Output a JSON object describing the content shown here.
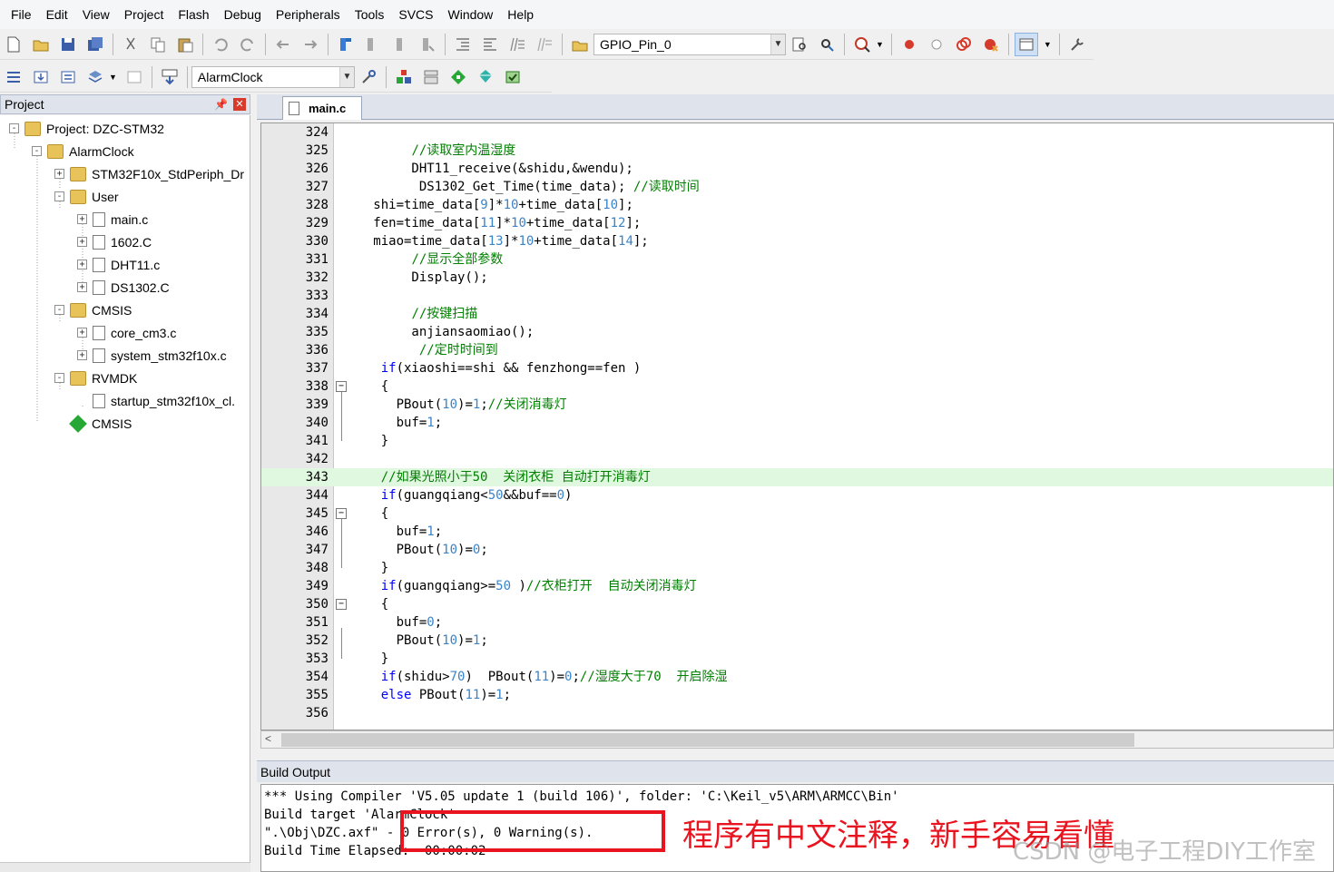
{
  "menu": [
    "File",
    "Edit",
    "View",
    "Project",
    "Flash",
    "Debug",
    "Peripherals",
    "Tools",
    "SVCS",
    "Window",
    "Help"
  ],
  "toolbar1": {
    "icons": [
      "new-file",
      "open-file",
      "save",
      "save-all",
      "cut",
      "copy",
      "paste",
      "undo",
      "redo",
      "nav-back",
      "nav-forward",
      "bookmark",
      "prev-bookmark",
      "next-bookmark",
      "clear-bookmarks",
      "indent",
      "unindent",
      "comment",
      "uncomment",
      "find-in-files"
    ],
    "find_combo": "GPIO_Pin_0",
    "icons2": [
      "incremental-find",
      "find-replace",
      "debug-session",
      "breakpoint",
      "disable-breakpoint",
      "kill-breakpoints",
      "kill-all-breakpoints",
      "window-layout",
      "configure"
    ]
  },
  "toolbar2": {
    "icons": [
      "translate",
      "build",
      "rebuild",
      "batch-build",
      "stop-build",
      "download"
    ],
    "target_combo": "AlarmClock",
    "icons2": [
      "target-options",
      "manage-components",
      "file-extensions",
      "run-time-env",
      "pack-installer",
      "select-packs"
    ]
  },
  "project_panel": {
    "title": "Project",
    "tree": [
      {
        "label": "Project: DZC-STM32",
        "kind": "project",
        "level": 0,
        "expander": "-"
      },
      {
        "label": "AlarmClock",
        "kind": "target",
        "level": 1,
        "expander": "-"
      },
      {
        "label": "STM32F10x_StdPeriph_Dr",
        "kind": "folder",
        "level": 2,
        "expander": "+"
      },
      {
        "label": "User",
        "kind": "folder",
        "level": 2,
        "expander": "-"
      },
      {
        "label": "main.c",
        "kind": "file",
        "level": 3,
        "expander": "+"
      },
      {
        "label": "1602.C",
        "kind": "file",
        "level": 3,
        "expander": "+"
      },
      {
        "label": "DHT11.c",
        "kind": "file",
        "level": 3,
        "expander": "+"
      },
      {
        "label": "DS1302.C",
        "kind": "file",
        "level": 3,
        "expander": "+"
      },
      {
        "label": "CMSIS",
        "kind": "folder",
        "level": 2,
        "expander": "-"
      },
      {
        "label": "core_cm3.c",
        "kind": "file",
        "level": 3,
        "expander": "+"
      },
      {
        "label": "system_stm32f10x.c",
        "kind": "file",
        "level": 3,
        "expander": "+"
      },
      {
        "label": "RVMDK",
        "kind": "folder",
        "level": 2,
        "expander": "-"
      },
      {
        "label": "startup_stm32f10x_cl.",
        "kind": "file",
        "level": 3,
        "expander": ""
      },
      {
        "label": "CMSIS",
        "kind": "component",
        "level": 2,
        "expander": ""
      }
    ]
  },
  "editor": {
    "tab": "main.c",
    "lines": [
      {
        "n": "324",
        "segs": [
          [
            "",
            ""
          ]
        ]
      },
      {
        "n": "325",
        "segs": [
          [
            "",
            "        "
          ],
          [
            "cm",
            "//读取室内温湿度"
          ]
        ]
      },
      {
        "n": "326",
        "segs": [
          [
            "",
            "        DHT11_receive(&shidu,&wendu);"
          ]
        ]
      },
      {
        "n": "327",
        "segs": [
          [
            "",
            "         DS1302_Get_Time(time_data); "
          ],
          [
            "cm",
            "//读取时间"
          ]
        ]
      },
      {
        "n": "328",
        "segs": [
          [
            "",
            "   shi=time_data["
          ],
          [
            "num",
            "9"
          ],
          [
            "",
            "]*"
          ],
          [
            "num",
            "10"
          ],
          [
            "",
            "+time_data["
          ],
          [
            "num",
            "10"
          ],
          [
            "",
            "];"
          ]
        ]
      },
      {
        "n": "329",
        "segs": [
          [
            "",
            "   fen=time_data["
          ],
          [
            "num",
            "11"
          ],
          [
            "",
            "]*"
          ],
          [
            "num",
            "10"
          ],
          [
            "",
            "+time_data["
          ],
          [
            "num",
            "12"
          ],
          [
            "",
            "];"
          ]
        ]
      },
      {
        "n": "330",
        "segs": [
          [
            "",
            "   miao=time_data["
          ],
          [
            "num",
            "13"
          ],
          [
            "",
            "]*"
          ],
          [
            "num",
            "10"
          ],
          [
            "",
            "+time_data["
          ],
          [
            "num",
            "14"
          ],
          [
            "",
            "];"
          ]
        ]
      },
      {
        "n": "331",
        "segs": [
          [
            "",
            "        "
          ],
          [
            "cm",
            "//显示全部参数"
          ]
        ]
      },
      {
        "n": "332",
        "segs": [
          [
            "",
            "        Display();"
          ]
        ]
      },
      {
        "n": "333",
        "segs": [
          [
            "",
            ""
          ]
        ]
      },
      {
        "n": "334",
        "segs": [
          [
            "",
            "        "
          ],
          [
            "cm",
            "//按键扫描"
          ]
        ]
      },
      {
        "n": "335",
        "segs": [
          [
            "",
            "        anjiansaomiao();"
          ]
        ]
      },
      {
        "n": "336",
        "segs": [
          [
            "",
            "         "
          ],
          [
            "cm",
            "//定时时间到"
          ]
        ]
      },
      {
        "n": "337",
        "segs": [
          [
            "",
            "    "
          ],
          [
            "kw",
            "if"
          ],
          [
            "",
            "(xiaoshi==shi && fenzhong==fen )"
          ]
        ]
      },
      {
        "n": "338",
        "segs": [
          [
            "",
            "    {"
          ]
        ],
        "fold": true
      },
      {
        "n": "339",
        "segs": [
          [
            "",
            "      PBout("
          ],
          [
            "num",
            "10"
          ],
          [
            "",
            ")="
          ],
          [
            "num",
            "1"
          ],
          [
            "",
            ";"
          ],
          [
            "cm",
            "//关闭消毒灯"
          ]
        ]
      },
      {
        "n": "340",
        "segs": [
          [
            "",
            "      buf="
          ],
          [
            "num",
            "1"
          ],
          [
            "",
            ";"
          ]
        ]
      },
      {
        "n": "341",
        "segs": [
          [
            "",
            "    }"
          ]
        ],
        "foldend": true
      },
      {
        "n": "342",
        "segs": [
          [
            "",
            ""
          ]
        ]
      },
      {
        "n": "343",
        "segs": [
          [
            "",
            "    "
          ],
          [
            "cm",
            "//如果光照小于50  关闭衣柜 自动打开消毒灯"
          ]
        ],
        "highlight": true
      },
      {
        "n": "344",
        "segs": [
          [
            "",
            "    "
          ],
          [
            "kw",
            "if"
          ],
          [
            "",
            "(guangqiang<"
          ],
          [
            "num",
            "50"
          ],
          [
            "",
            "&&buf=="
          ],
          [
            "num",
            "0"
          ],
          [
            "",
            ")"
          ]
        ]
      },
      {
        "n": "345",
        "segs": [
          [
            "",
            "    {"
          ]
        ],
        "fold": true
      },
      {
        "n": "346",
        "segs": [
          [
            "",
            "      buf="
          ],
          [
            "num",
            "1"
          ],
          [
            "",
            ";"
          ]
        ]
      },
      {
        "n": "347",
        "segs": [
          [
            "",
            "      PBout("
          ],
          [
            "num",
            "10"
          ],
          [
            "",
            ")="
          ],
          [
            "num",
            "0"
          ],
          [
            "",
            ";"
          ]
        ]
      },
      {
        "n": "348",
        "segs": [
          [
            "",
            "    }"
          ]
        ],
        "foldend": true
      },
      {
        "n": "349",
        "segs": [
          [
            "",
            "    "
          ],
          [
            "kw",
            "if"
          ],
          [
            "",
            "(guangqiang>="
          ],
          [
            "num",
            "50"
          ],
          [
            "",
            " )"
          ],
          [
            "cm",
            "//衣柜打开  自动关闭消毒灯"
          ]
        ]
      },
      {
        "n": "350",
        "segs": [
          [
            "",
            "    {"
          ]
        ],
        "fold": true
      },
      {
        "n": "351",
        "segs": [
          [
            "",
            "      buf="
          ],
          [
            "num",
            "0"
          ],
          [
            "",
            ";"
          ]
        ]
      },
      {
        "n": "352",
        "segs": [
          [
            "",
            "      PBout("
          ],
          [
            "num",
            "10"
          ],
          [
            "",
            ")="
          ],
          [
            "num",
            "1"
          ],
          [
            "",
            ";"
          ]
        ]
      },
      {
        "n": "353",
        "segs": [
          [
            "",
            "    }"
          ]
        ],
        "foldend": true
      },
      {
        "n": "354",
        "segs": [
          [
            "",
            "    "
          ],
          [
            "kw",
            "if"
          ],
          [
            "",
            "(shidu>"
          ],
          [
            "num",
            "70"
          ],
          [
            "",
            ")  PBout("
          ],
          [
            "num",
            "11"
          ],
          [
            "",
            ")="
          ],
          [
            "num",
            "0"
          ],
          [
            "",
            ";"
          ],
          [
            "cm",
            "//湿度大于70  开启除湿"
          ]
        ]
      },
      {
        "n": "355",
        "segs": [
          [
            "",
            "    "
          ],
          [
            "kw",
            "else"
          ],
          [
            "",
            " PBout("
          ],
          [
            "num",
            "11"
          ],
          [
            "",
            ")="
          ],
          [
            "num",
            "1"
          ],
          [
            "",
            ";"
          ]
        ]
      },
      {
        "n": "356",
        "segs": [
          [
            "",
            ""
          ]
        ]
      }
    ]
  },
  "build_output": {
    "title": "Build Output",
    "lines": [
      "*** Using Compiler 'V5.05 update 1 (build 106)', folder: 'C:\\Keil_v5\\ARM\\ARMCC\\Bin'",
      "Build target 'AlarmClock'",
      "\".\\Obj\\DZC.axf\" - 0 Error(s), 0 Warning(s).",
      "Build Time Elapsed:  00:00:02"
    ]
  },
  "annotation": "程序有中文注释，新手容易看懂",
  "watermark": "CSDN @电子工程DIY工作室",
  "colors": {
    "keyword": "#0000ff",
    "comment": "#008000",
    "number": "#3a83c9",
    "annotation": "#e8141f",
    "highlight_line": "#e0f8e0"
  }
}
